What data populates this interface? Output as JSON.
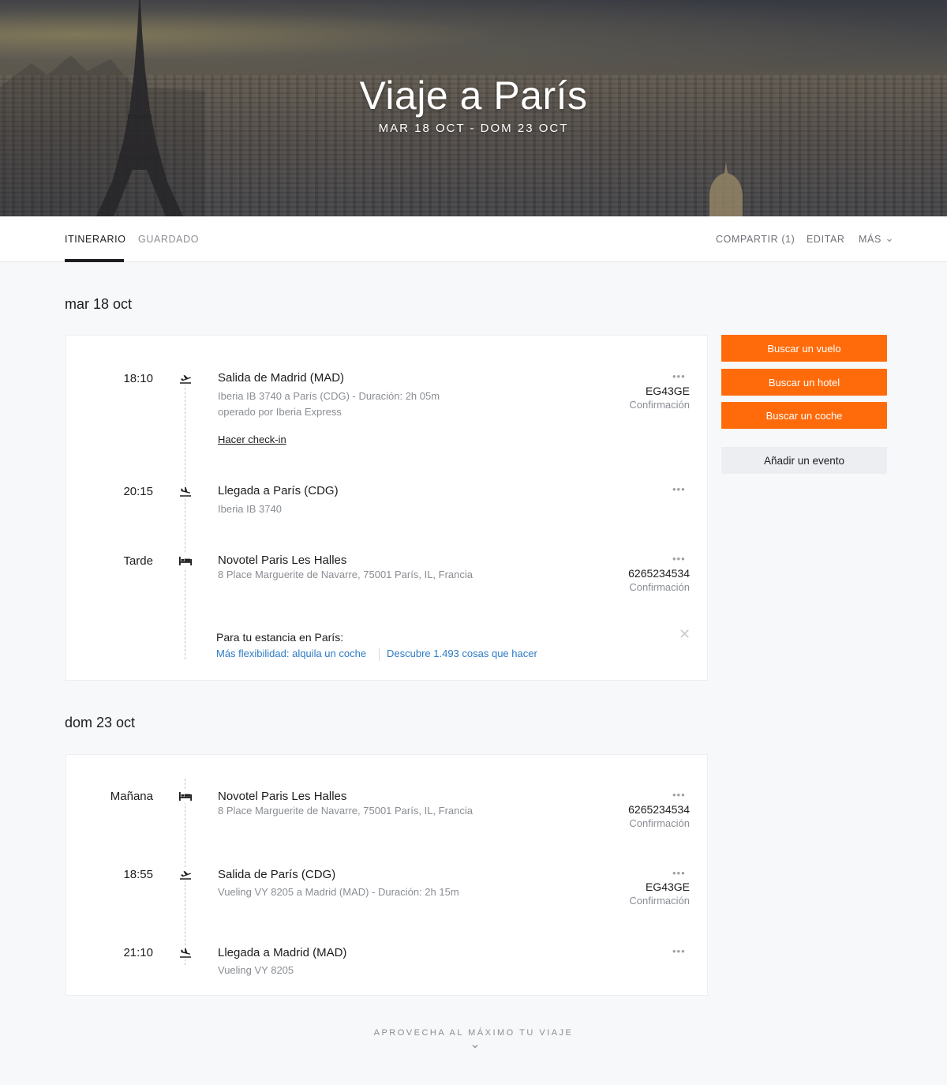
{
  "trip": {
    "title": "Viaje a París",
    "dates": "MAR 18 OCT - DOM 23 OCT"
  },
  "tabs": {
    "itinerary": "ITINERARIO",
    "saved": "GUARDADO"
  },
  "actions": {
    "share": "COMPARTIR (1)",
    "edit": "EDITAR",
    "more": "MÁS"
  },
  "days": [
    {
      "heading": "mar 18 oct",
      "events": [
        {
          "time": "18:10",
          "icon": "plane-takeoff-icon",
          "title": "Salida de Madrid (MAD)",
          "sub1": "Iberia IB 3740 a París (CDG) - Duración: 2h 05m",
          "sub2": "operado por Iberia Express",
          "link": "Hacer check-in",
          "menu": "•••",
          "code": "EG43GE",
          "conf": "Confirmación"
        },
        {
          "time": "20:15",
          "icon": "plane-landing-icon",
          "title": "Llegada a París (CDG)",
          "sub1": "Iberia IB 3740",
          "menu": "•••"
        },
        {
          "time": "Tarde",
          "icon": "bed-icon",
          "title": "Novotel Paris Les Halles",
          "sub1": "8 Place Marguerite de Navarre, 75001 París, IL, Francia",
          "menu": "•••",
          "code": "6265234534",
          "conf": "Confirmación"
        }
      ],
      "promo": {
        "title": "Para tu estancia en París:",
        "link1": "Más flexibilidad: alquila un coche",
        "link2": "Descubre 1.493 cosas que hacer",
        "close": "✕"
      }
    },
    {
      "heading": "dom 23 oct",
      "events": [
        {
          "time": "Mañana",
          "icon": "bed-icon",
          "title": "Novotel Paris Les Halles",
          "sub1": "8 Place Marguerite de Navarre, 75001 París, IL, Francia",
          "menu": "•••",
          "code": "6265234534",
          "conf": "Confirmación"
        },
        {
          "time": "18:55",
          "icon": "plane-takeoff-icon",
          "title": "Salida de París (CDG)",
          "sub1": "Vueling VY 8205 a Madrid (MAD) - Duración: 2h 15m",
          "menu": "•••",
          "code": "EG43GE",
          "conf": "Confirmación"
        },
        {
          "time": "21:10",
          "icon": "plane-landing-icon",
          "title": "Llegada a Madrid (MAD)",
          "sub1": "Vueling VY 8205",
          "menu": "•••"
        }
      ]
    }
  ],
  "sidebar": {
    "flight": "Buscar un vuelo",
    "hotel": "Buscar un hotel",
    "car": "Buscar un coche",
    "event": "Añadir un evento"
  },
  "footer": {
    "cta": "APROVECHA AL MÁXIMO TU VIAJE"
  },
  "colors": {
    "accent": "#ff6b0b",
    "link": "#2e7bc4",
    "background": "#f7f8fa"
  }
}
